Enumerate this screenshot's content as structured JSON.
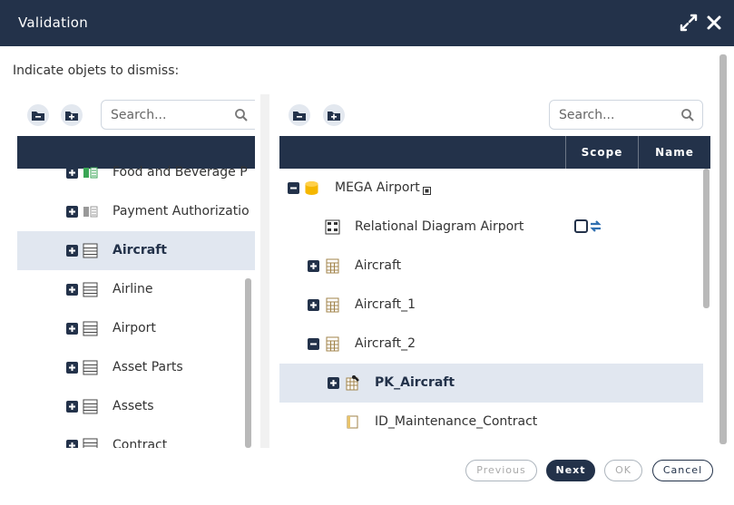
{
  "window": {
    "title": "Validation"
  },
  "instructions": "Indicate objets to dismiss:",
  "left": {
    "search_placeholder": "Search...",
    "items": [
      {
        "label": "Food and Beverage P",
        "icon": "green-tag-icon"
      },
      {
        "label": "Payment Authorizatio",
        "icon": "grey-tag-icon"
      },
      {
        "label": "Aircraft",
        "icon": "table-icon",
        "selected": true
      },
      {
        "label": "Airline",
        "icon": "table-icon"
      },
      {
        "label": "Airport",
        "icon": "table-icon"
      },
      {
        "label": "Asset Parts",
        "icon": "table-icon"
      },
      {
        "label": "Assets",
        "icon": "table-icon"
      },
      {
        "label": "Contract",
        "icon": "table-icon"
      }
    ]
  },
  "right": {
    "search_placeholder": "Search...",
    "columns": {
      "scope": "Scope",
      "name": "Name"
    },
    "rows": [
      {
        "label": "MEGA Airport",
        "icon": "database-icon",
        "toggle": "minus"
      },
      {
        "label": "Relational Diagram Airport",
        "icon": "diagram-icon"
      },
      {
        "label": "Aircraft",
        "icon": "calculator-icon",
        "toggle": "plus"
      },
      {
        "label": "Aircraft_1",
        "icon": "calculator-icon",
        "toggle": "plus"
      },
      {
        "label": "Aircraft_2",
        "icon": "calculator-icon",
        "toggle": "minus"
      },
      {
        "label": "PK_Aircraft",
        "icon": "key-icon",
        "toggle": "plus",
        "selected": true
      },
      {
        "label": "ID_Maintenance_Contract",
        "icon": "column-icon"
      }
    ]
  },
  "footer": {
    "previous": "Previous",
    "next": "Next",
    "ok": "OK",
    "cancel": "Cancel"
  },
  "colors": {
    "header": "#23324a",
    "selected_row": "#e1e7f0"
  }
}
